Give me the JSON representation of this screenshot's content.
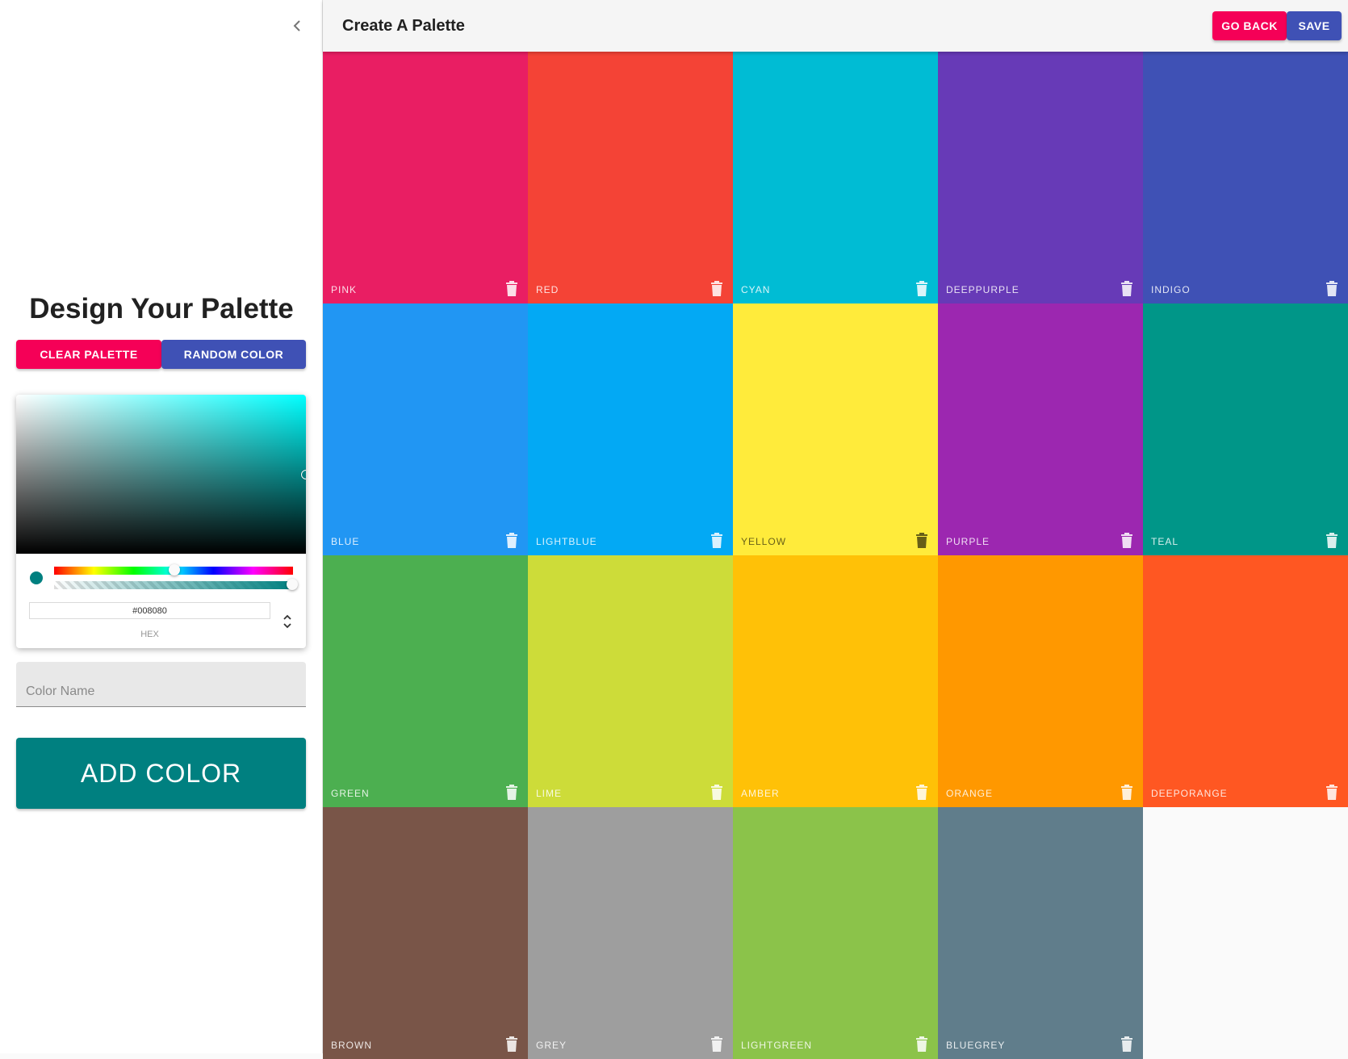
{
  "drawer": {
    "title": "Design Your Palette",
    "clear_label": "Clear Palette",
    "random_label": "Random Color",
    "picker": {
      "hex_value": "#008080",
      "hex_label": "HEX",
      "current_color": "#008080"
    },
    "name_placeholder": "Color Name",
    "add_label": "Add Color"
  },
  "appbar": {
    "title": "Create A Palette",
    "go_back_label": "Go Back",
    "save_label": "Save"
  },
  "colors": [
    {
      "name": "pink",
      "color": "#e91e63"
    },
    {
      "name": "red",
      "color": "#f44336"
    },
    {
      "name": "cyan",
      "color": "#00bcd4"
    },
    {
      "name": "deeppurple",
      "color": "#673ab7"
    },
    {
      "name": "indigo",
      "color": "#3f51b5"
    },
    {
      "name": "blue",
      "color": "#2196f3"
    },
    {
      "name": "lightblue",
      "color": "#03a9f4"
    },
    {
      "name": "yellow",
      "color": "#ffeb3b"
    },
    {
      "name": "purple",
      "color": "#9c27b0"
    },
    {
      "name": "teal",
      "color": "#009688"
    },
    {
      "name": "green",
      "color": "#4caf50"
    },
    {
      "name": "lime",
      "color": "#cddc39"
    },
    {
      "name": "amber",
      "color": "#ffc107"
    },
    {
      "name": "orange",
      "color": "#ff9800"
    },
    {
      "name": "deeporange",
      "color": "#ff5722"
    },
    {
      "name": "brown",
      "color": "#795548"
    },
    {
      "name": "grey",
      "color": "#9e9e9e"
    },
    {
      "name": "lightgreen",
      "color": "#8bc34a"
    },
    {
      "name": "bluegrey",
      "color": "#607d8b"
    }
  ]
}
